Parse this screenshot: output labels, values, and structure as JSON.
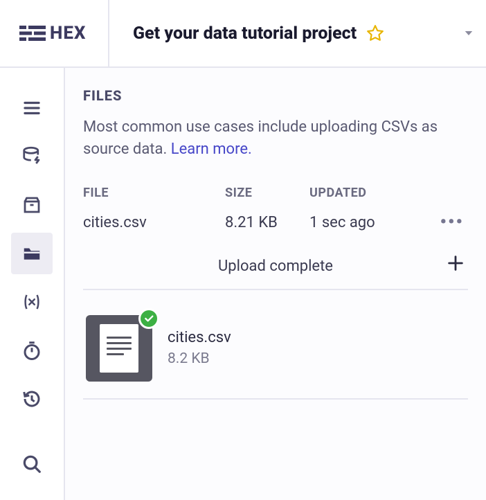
{
  "header": {
    "logo_text": "HEX",
    "project_title": "Get your data tutorial project"
  },
  "files_panel": {
    "heading": "FILES",
    "description_prefix": "Most common use cases include uploading CSVs as source data. ",
    "learn_more": "Learn more.",
    "columns": {
      "file": "FILE",
      "size": "SIZE",
      "updated": "UPDATED"
    },
    "rows": [
      {
        "name": "cities.csv",
        "size": "8.21 KB",
        "updated": "1 sec ago"
      }
    ],
    "upload_status": "Upload complete",
    "uploaded_item": {
      "name": "cities.csv",
      "size": "8.2 KB"
    }
  }
}
